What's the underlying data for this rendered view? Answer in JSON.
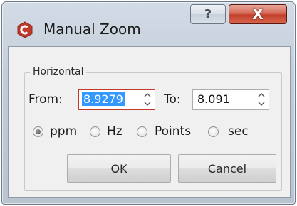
{
  "window": {
    "title": "Manual Zoom",
    "help_glyph": "?",
    "close_glyph": "X"
  },
  "horizontal": {
    "group_title": "Horizontal",
    "from_label": "From:",
    "from_value": "8.9279",
    "to_label": "To:",
    "to_value": "8.091"
  },
  "units": {
    "options": [
      {
        "label": "ppm",
        "selected": true
      },
      {
        "label": "Hz",
        "selected": false
      },
      {
        "label": "Points",
        "selected": false
      },
      {
        "label": "sec",
        "selected": false
      }
    ]
  },
  "buttons": {
    "ok_label": "OK",
    "cancel_label": "Cancel"
  },
  "colors": {
    "app_icon": "#c0392b",
    "selection": "#3399ff",
    "focus_border": "#c0392b",
    "close_button": "#c2402a"
  },
  "icons": {
    "app": "app-logo-icon",
    "help": "help-icon",
    "close": "close-icon",
    "spin_up": "chevron-up-icon",
    "spin_down": "chevron-down-icon"
  }
}
